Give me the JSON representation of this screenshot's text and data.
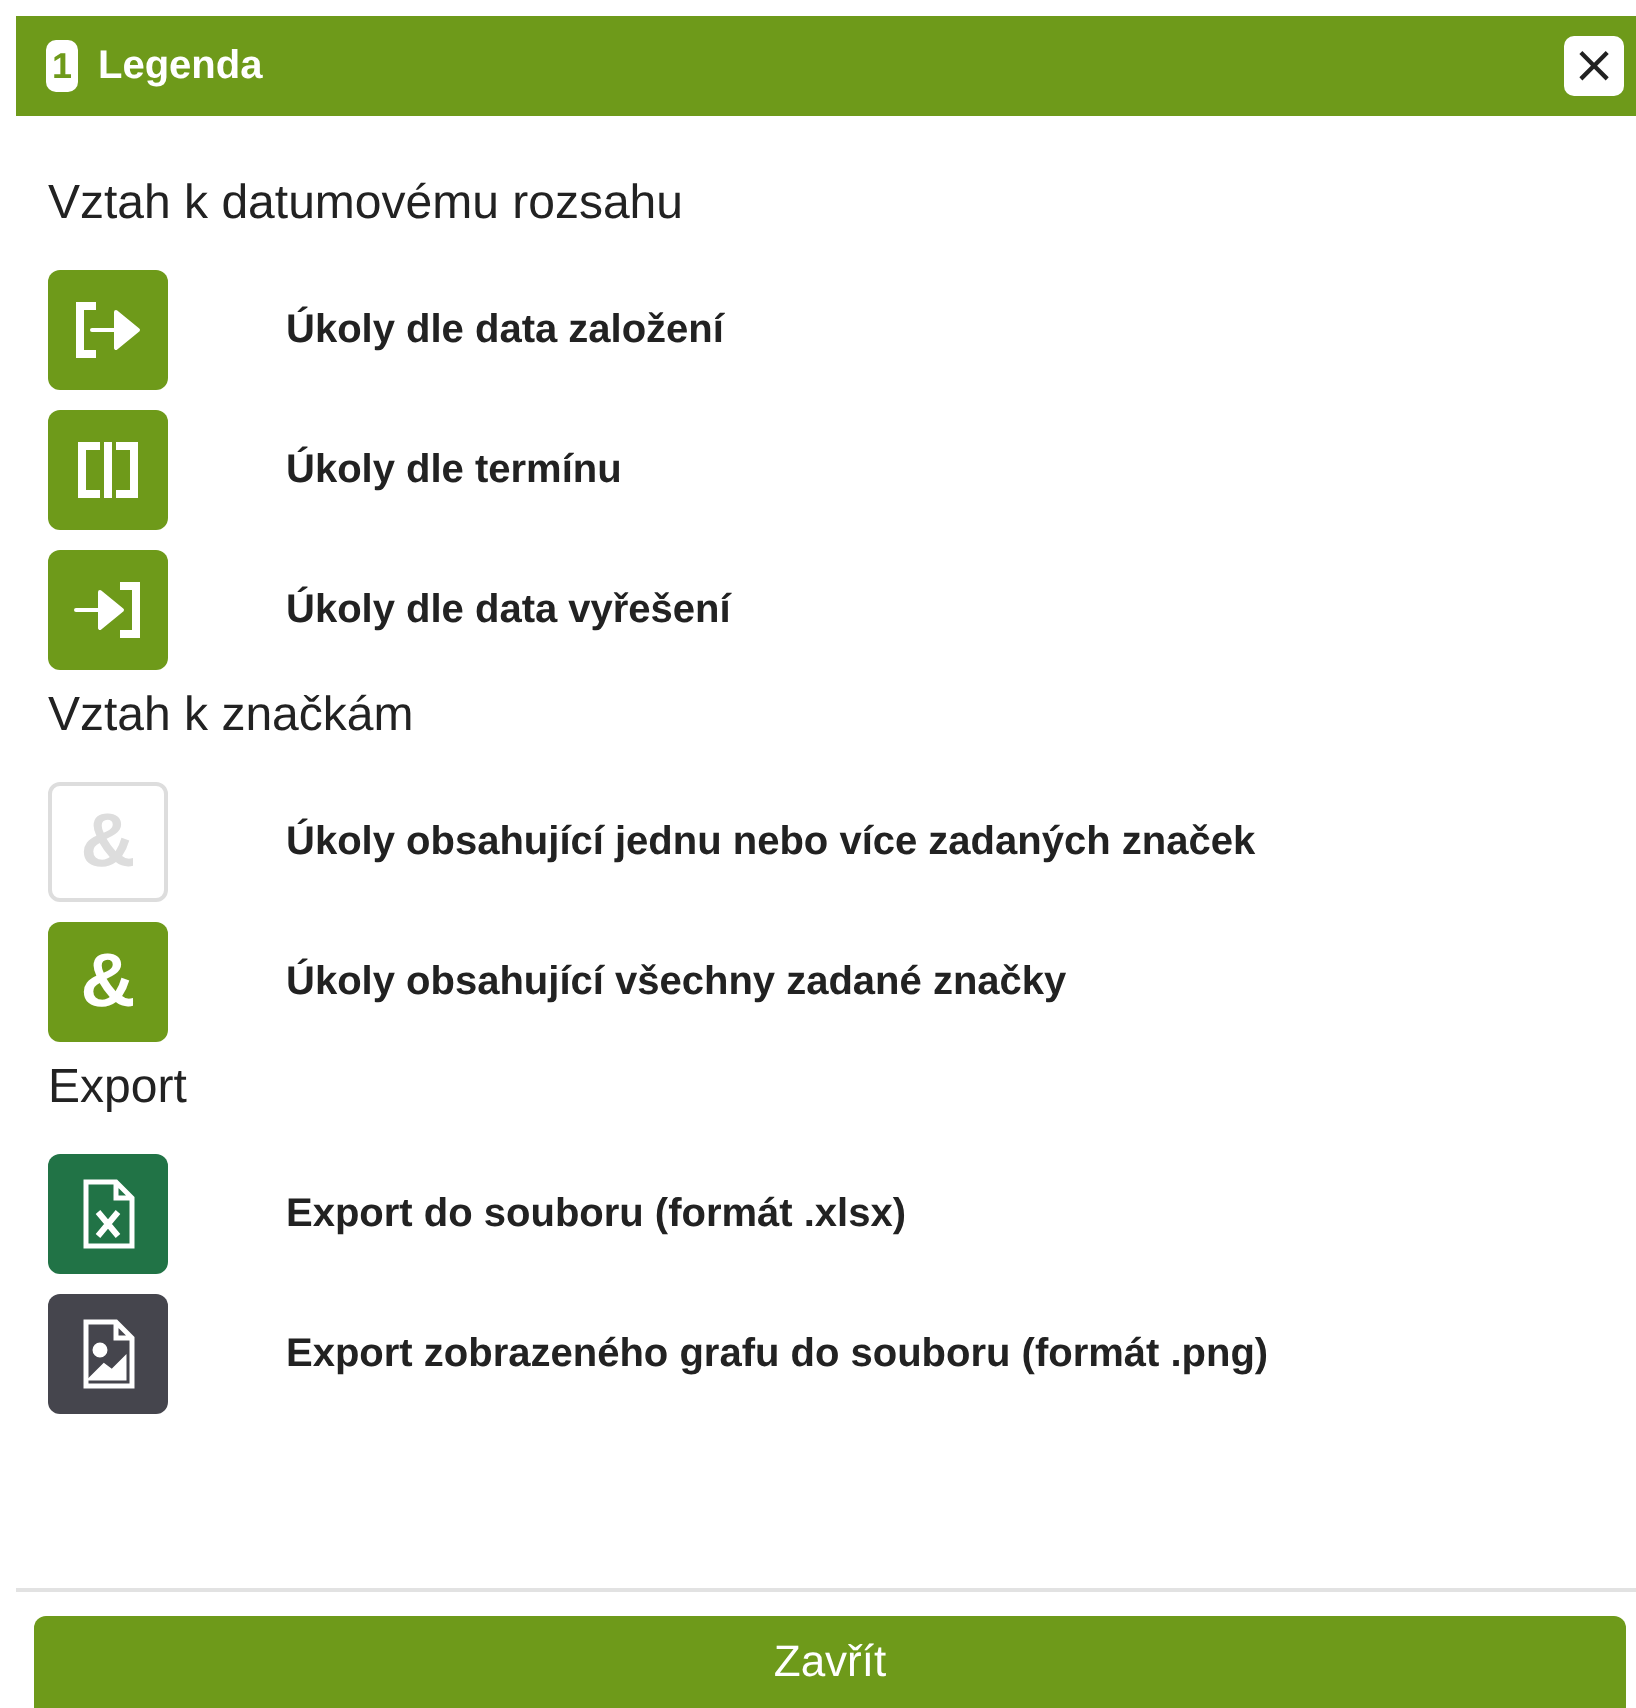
{
  "window": {
    "logo": "1",
    "title": "Legenda",
    "close": "×"
  },
  "sections": [
    {
      "heading": "Vztah k datumovému rozsahu",
      "items": [
        {
          "kind": "start",
          "label": "Úkoly dle data založení"
        },
        {
          "kind": "deadline",
          "label": "Úkoly dle termínu"
        },
        {
          "kind": "end",
          "label": "Úkoly dle data vyřešení"
        }
      ]
    },
    {
      "heading": "Vztah k značkám",
      "items": [
        {
          "kind": "and-any",
          "symbol": "&",
          "label": "Úkoly obsahující jednu nebo více zadaných značek"
        },
        {
          "kind": "and-all",
          "symbol": "&",
          "label": "Úkoly obsahující všechny zadané značky"
        }
      ]
    },
    {
      "heading": "Export",
      "items": [
        {
          "kind": "xlsx",
          "label": "Export do souboru (formát .xlsx)"
        },
        {
          "kind": "png",
          "label": "Export zobrazeného grafu do souboru (formát .png)"
        }
      ]
    }
  ],
  "buttons": [
    "Zavřít"
  ]
}
